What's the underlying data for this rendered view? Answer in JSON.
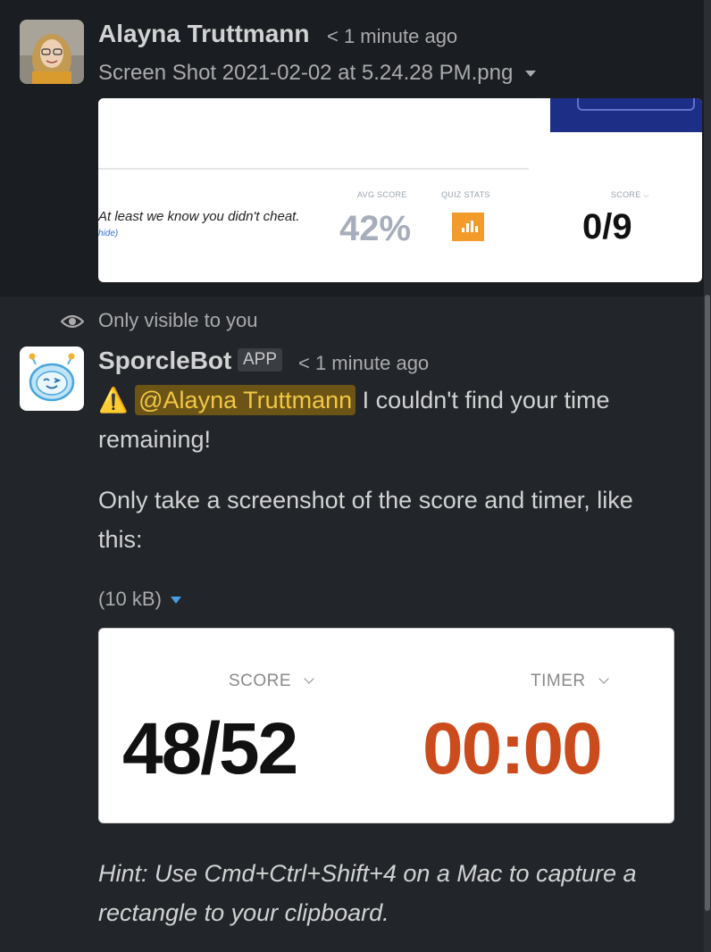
{
  "message1": {
    "author": "Alayna Truttmann",
    "time": "< 1 minute ago",
    "attachment_name": "Screen Shot 2021-02-02 at 5.24.28 PM.png",
    "screenshot": {
      "cheat_text": "At least we know you didn't cheat.",
      "hide_link": "hide)",
      "avg_score_label": "AVG SCORE",
      "avg_score_value": "42%",
      "quiz_stats_label": "QUIZ STATS",
      "score_label": "SCORE",
      "score_value": "0/9"
    }
  },
  "ephemeral": {
    "visibility": "Only visible to you"
  },
  "message2": {
    "author": "SporcleBot",
    "badge": "APP",
    "time": "< 1 minute ago",
    "warning_emoji": "⚠️",
    "mention": "@Alayna Truttmann",
    "line1_rest": " I couldn't find your time",
    "line2": "remaining!",
    "instruction_line1": "Only take a screenshot of the score and timer, like",
    "instruction_line2": "this:",
    "attachment_size": "(10 kB)",
    "example": {
      "score_label": "SCORE",
      "score_value": "48/52",
      "timer_label": "TIMER",
      "timer_value": "00:00",
      "timer_color": "#cc4b1c"
    },
    "hint_line1": "Hint: Use Cmd+Ctrl+Shift+4 on a Mac to capture a",
    "hint_line2": "rectangle to your clipboard."
  },
  "colors": {
    "background": "#222529",
    "top_message_background": "#1a1d21",
    "mention_background": "#6b5416",
    "mention_text": "#f2c744"
  }
}
